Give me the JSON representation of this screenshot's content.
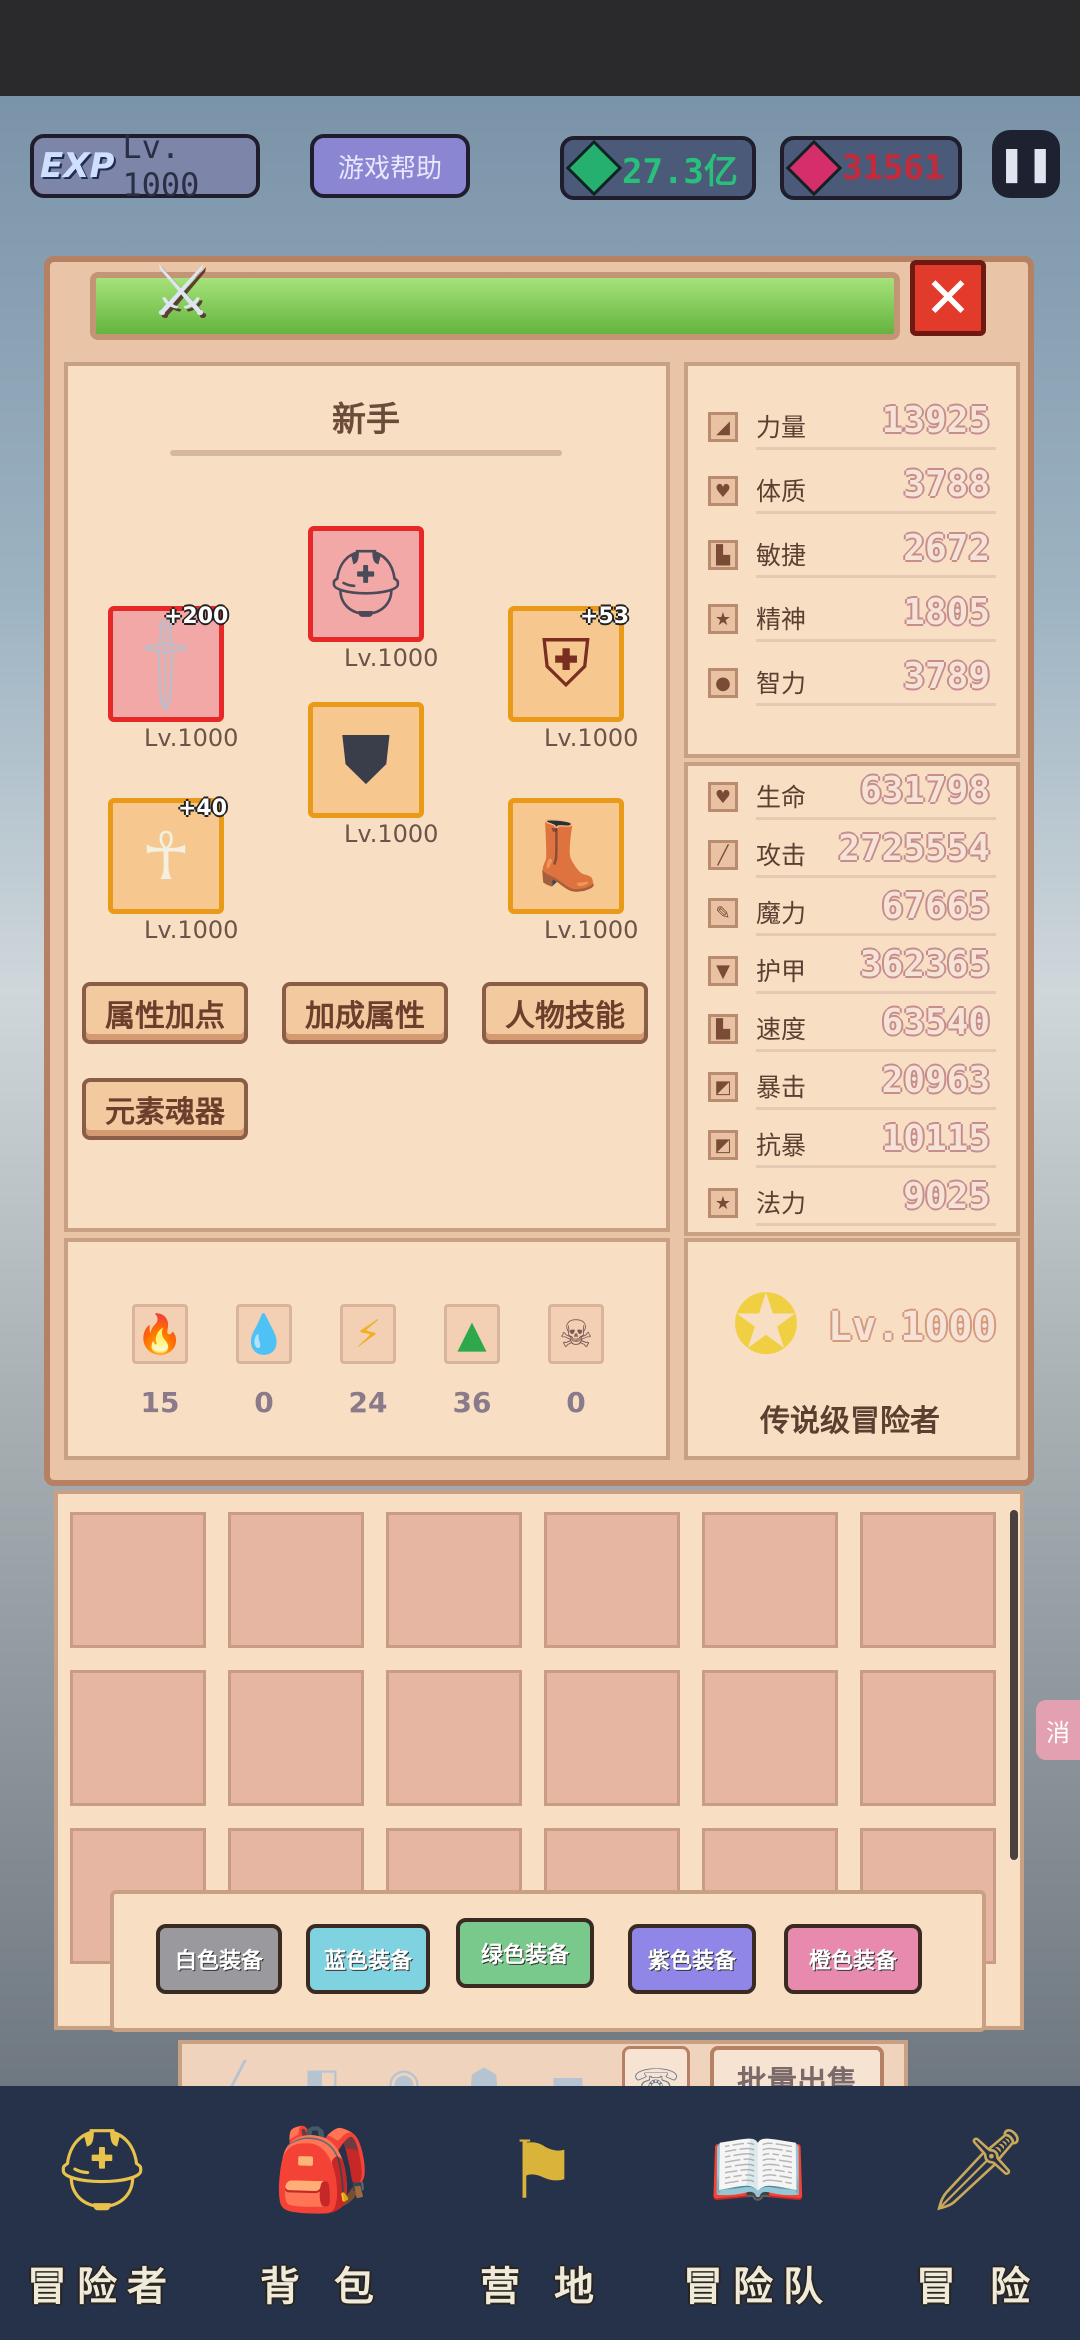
{
  "topbar": {
    "exp_tag": "EXP",
    "player_level": "Lv. 1000",
    "help_button": "游戏帮助",
    "emerald_amount": "27.3亿",
    "ruby_amount": "31561",
    "pause_symbol": "❚❚"
  },
  "dialog": {
    "close_symbol": "✕",
    "class_title": "新手",
    "equipment": {
      "weapon": {
        "plus": "+200",
        "level": "Lv.1000",
        "icon": "sword-icon"
      },
      "helmet": {
        "level": "Lv.1000",
        "icon": "helmet-icon"
      },
      "shield": {
        "plus": "+53",
        "level": "Lv.1000",
        "icon": "shield-icon"
      },
      "armor": {
        "level": "Lv.1000",
        "icon": "armor-icon"
      },
      "amulet": {
        "plus": "+40",
        "level": "Lv.1000",
        "icon": "ankh-amulet-icon"
      },
      "boots": {
        "level": "Lv.1000",
        "icon": "boots-icon"
      }
    },
    "buttons": {
      "attr_points": "属性加点",
      "bonus_attr": "加成属性",
      "char_skills": "人物技能",
      "element_soul": "元素魂器"
    },
    "elements": [
      {
        "icon": "fire-icon",
        "count": "15"
      },
      {
        "icon": "water-icon",
        "count": "0"
      },
      {
        "icon": "lightning-icon",
        "count": "24"
      },
      {
        "icon": "earth-icon",
        "count": "36"
      },
      {
        "icon": "skull-icon",
        "count": "0"
      }
    ],
    "base_stats": [
      {
        "label": "力量",
        "value": "13925",
        "icon": "strength-icon"
      },
      {
        "label": "体质",
        "value": "3788",
        "icon": "heart-icon"
      },
      {
        "label": "敏捷",
        "value": "2672",
        "icon": "boot-icon"
      },
      {
        "label": "精神",
        "value": "1805",
        "icon": "star-icon"
      },
      {
        "label": "智力",
        "value": "3789",
        "icon": "brain-icon"
      }
    ],
    "combat_stats": [
      {
        "label": "生命",
        "value": "631798",
        "icon": "heart-icon"
      },
      {
        "label": "攻击",
        "value": "2725554",
        "icon": "sword-icon"
      },
      {
        "label": "魔力",
        "value": "67665",
        "icon": "wand-icon"
      },
      {
        "label": "护甲",
        "value": "362365",
        "icon": "shield-icon"
      },
      {
        "label": "速度",
        "value": "63540",
        "icon": "boot-icon"
      },
      {
        "label": "暴击",
        "value": "20963",
        "icon": "crit-icon"
      },
      {
        "label": "抗暴",
        "value": "10115",
        "icon": "crit-resist-icon"
      },
      {
        "label": "法力",
        "value": "9025",
        "icon": "star-icon"
      }
    ],
    "rank": {
      "level": "Lv.1000",
      "title": "传说级冒险者"
    }
  },
  "inventory": {
    "filters": [
      {
        "label": "白色装备",
        "color": "#9a9a9e"
      },
      {
        "label": "蓝色装备",
        "color": "#7fd3e0"
      },
      {
        "label": "绿色装备",
        "color": "#78c98b"
      },
      {
        "label": "紫色装备",
        "color": "#8f86e8"
      },
      {
        "label": "橙色装备",
        "color": "#e88aae"
      }
    ],
    "bulk_sell": "批量出售",
    "side_tab": "消"
  },
  "nav": [
    {
      "label": "冒险者",
      "icon": "adventurer-helmet-icon"
    },
    {
      "label": "背 包",
      "icon": "backpack-icon"
    },
    {
      "label": "营 地",
      "icon": "camp-banner-icon"
    },
    {
      "label": "冒险队",
      "icon": "book-icon"
    },
    {
      "label": "冒 险",
      "icon": "sword-icon"
    }
  ]
}
